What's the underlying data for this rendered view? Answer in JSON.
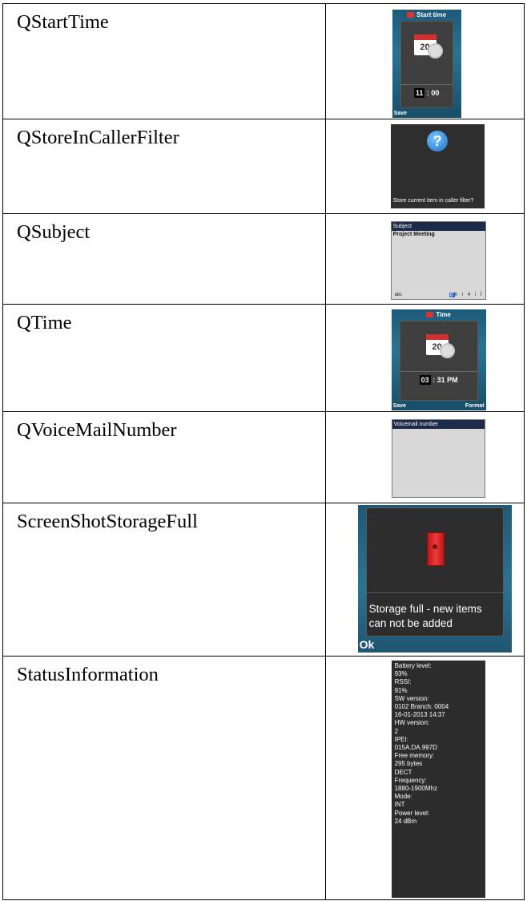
{
  "rows": [
    {
      "name": "QStartTime"
    },
    {
      "name": "QStoreInCallerFilter"
    },
    {
      "name": "QSubject"
    },
    {
      "name": "QTime"
    },
    {
      "name": "QVoiceMailNumber"
    },
    {
      "name": "ScreenShotStorageFull"
    },
    {
      "name": "StatusInformation"
    }
  ],
  "screens": {
    "start_time": {
      "title": "Start time",
      "calendar_day": "20",
      "hour": "11",
      "minute": ": 00",
      "left_soft": "Save"
    },
    "store_filter": {
      "message": "Store current item in caller filter?"
    },
    "subject": {
      "header": "Subject",
      "text": "Project Meeting",
      "mode": "abc",
      "first_key": "g",
      "keys": "h i 4 i Ï"
    },
    "time": {
      "title": "Time",
      "calendar_day": "20",
      "hour": "03",
      "rest": ": 31 PM",
      "left_soft": "Save",
      "right_soft": "Format"
    },
    "voicemail": {
      "header": "Voicemail number"
    },
    "storage_full": {
      "message": "Storage full - new items can not be added",
      "soft": "Ok"
    },
    "status": {
      "lines": [
        "Battery level:",
        "93%",
        "RSSI:",
        "91%",
        "SW version:",
        "0102 Branch: 0004",
        "16-01-2013   14:37",
        "HW version:",
        "2",
        "IPEI:",
        "015A.DA.997D",
        "Free memory:",
        "295 bytes",
        "DECT",
        "Frequency:",
        "1880-1900Mhz",
        "Mode:",
        "INT",
        "Power level:",
        "24 dBm"
      ]
    }
  }
}
